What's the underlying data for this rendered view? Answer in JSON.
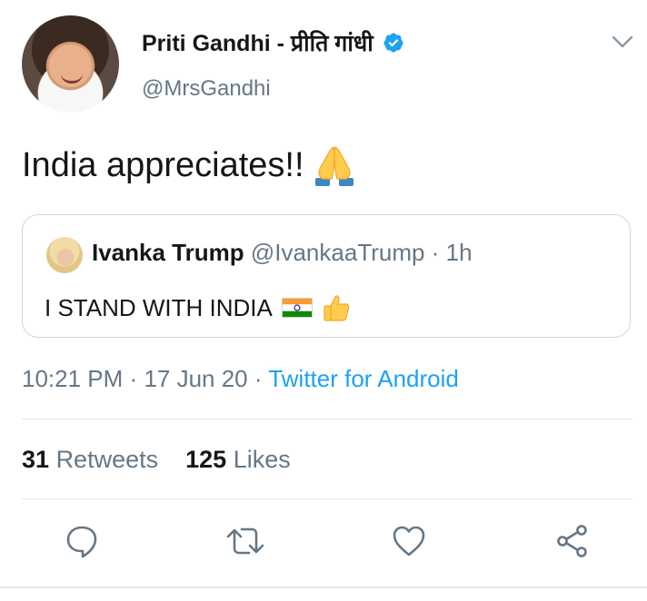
{
  "tweet": {
    "author": {
      "display_name": "Priti Gandhi - प्रीति गांधी",
      "handle": "@MrsGandhi",
      "verified": true
    },
    "text": "India appreciates!!",
    "emoji": "folded-hands-emoji",
    "quoted": {
      "display_name": "Ivanka Trump",
      "handle": "@IvankaaTrump",
      "separator": "·",
      "time_ago": "1h",
      "text": "I STAND WITH INDIA",
      "emojis": [
        "india-flag-emoji",
        "thumbs-up-emoji"
      ]
    },
    "timestamp": {
      "time": "10:21 PM",
      "separator": "·",
      "date": "17 Jun 20",
      "separator2": "·",
      "source": "Twitter for Android"
    },
    "stats": {
      "retweets_count": "31",
      "retweets_label": "Retweets",
      "likes_count": "125",
      "likes_label": "Likes"
    }
  },
  "colors": {
    "link": "#1da1f2",
    "secondary_text": "#657786",
    "primary_text": "#14171a",
    "border": "#ccd6dd"
  }
}
